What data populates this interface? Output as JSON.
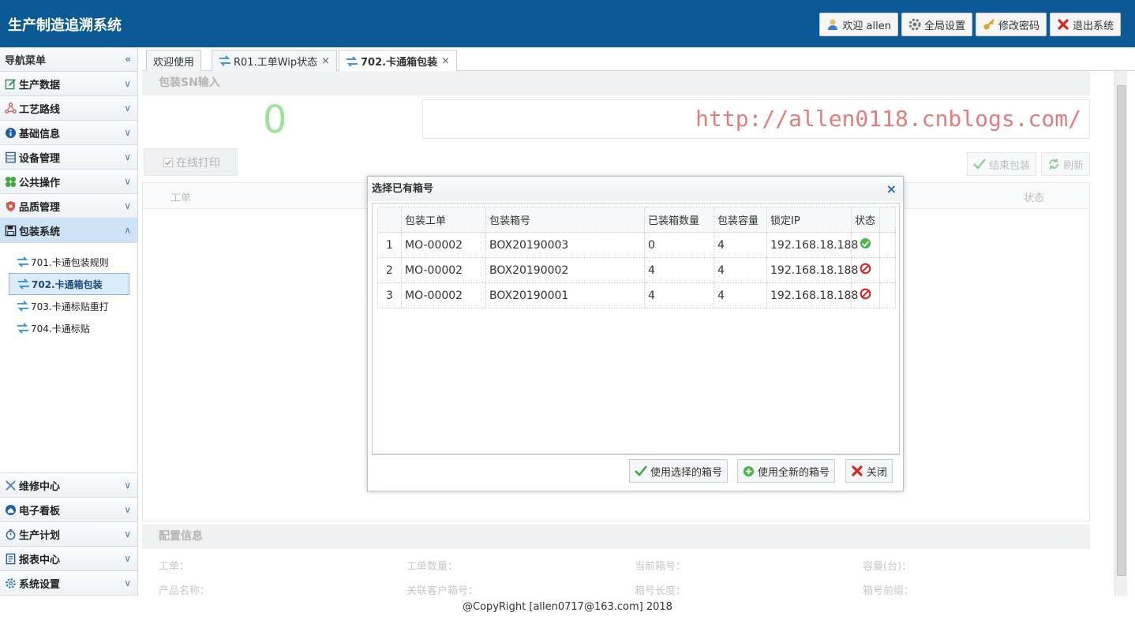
{
  "header": {
    "title": "生产制造追溯系统",
    "buttons": {
      "welcome": "欢迎 allen",
      "settings": "全局设置",
      "password": "修改密码",
      "logout": "退出系统"
    }
  },
  "sidebar": {
    "heading": "导航菜单",
    "groups_top": [
      {
        "label": "生产数据",
        "icon": "edit-icon"
      },
      {
        "label": "工艺路线",
        "icon": "route-icon"
      },
      {
        "label": "基础信息",
        "icon": "info-icon"
      },
      {
        "label": "设备管理",
        "icon": "device-icon"
      },
      {
        "label": "公共操作",
        "icon": "clover-icon"
      },
      {
        "label": "品质管理",
        "icon": "shield-icon"
      },
      {
        "label": "包装系统",
        "icon": "floppy-icon"
      }
    ],
    "packaging_items": [
      {
        "label": "701.卡通包装规则"
      },
      {
        "label": "702.卡通箱包装"
      },
      {
        "label": "703.卡通标贴重打"
      },
      {
        "label": "704.卡通标贴"
      }
    ],
    "groups_bottom": [
      {
        "label": "维修中心",
        "icon": "tools-icon"
      },
      {
        "label": "电子看板",
        "icon": "board-icon"
      },
      {
        "label": "生产计划",
        "icon": "timer-icon"
      },
      {
        "label": "报表中心",
        "icon": "report-icon"
      },
      {
        "label": "系统设置",
        "icon": "gear-icon"
      }
    ]
  },
  "tabs": [
    {
      "label": "欢迎使用"
    },
    {
      "label": "R01.工单Wip状态"
    },
    {
      "label": "702.卡通箱包装"
    }
  ],
  "main": {
    "sn_section_title": "包装SN输入",
    "count": "0",
    "url": "http://allen0118.cnblogs.com/",
    "print_online": "在线打印",
    "finish_button": "结束包装",
    "refresh_button": "刷新",
    "grid_col_order": "工单",
    "grid_col_status": "状态",
    "config_section_title": "配置信息",
    "config_labels": {
      "order": "工单：",
      "order_qty": "工单数量：",
      "current_box": "当前箱号：",
      "capacity": "容量(台)：",
      "product_name": "产品名称：",
      "customer_box": "关联客户箱号：",
      "box_length": "箱号长度：",
      "box_prefix": "箱号前缀："
    }
  },
  "modal": {
    "title": "选择已有箱号",
    "columns": [
      "包装工单",
      "包装箱号",
      "已装箱数量",
      "包装容量",
      "锁定IP",
      "状态"
    ],
    "rows": [
      {
        "n": "1",
        "order": "MO-00002",
        "box": "BOX20190003",
        "packed": "0",
        "capacity": "4",
        "ip": "192.168.18.188",
        "status": "available"
      },
      {
        "n": "2",
        "order": "MO-00002",
        "box": "BOX20190002",
        "packed": "4",
        "capacity": "4",
        "ip": "192.168.18.188",
        "status": "full"
      },
      {
        "n": "3",
        "order": "MO-00002",
        "box": "BOX20190001",
        "packed": "4",
        "capacity": "4",
        "ip": "192.168.18.188",
        "status": "full"
      }
    ],
    "buttons": {
      "use_selected": "使用选择的箱号",
      "use_new": "使用全新的箱号",
      "close": "关闭"
    }
  },
  "footer": "@CopyRight [allen0717@163.com] 2018",
  "colors": {
    "header_bg": "#0b5a95",
    "accent": "#4ccb4c",
    "url": "#cc1111"
  }
}
